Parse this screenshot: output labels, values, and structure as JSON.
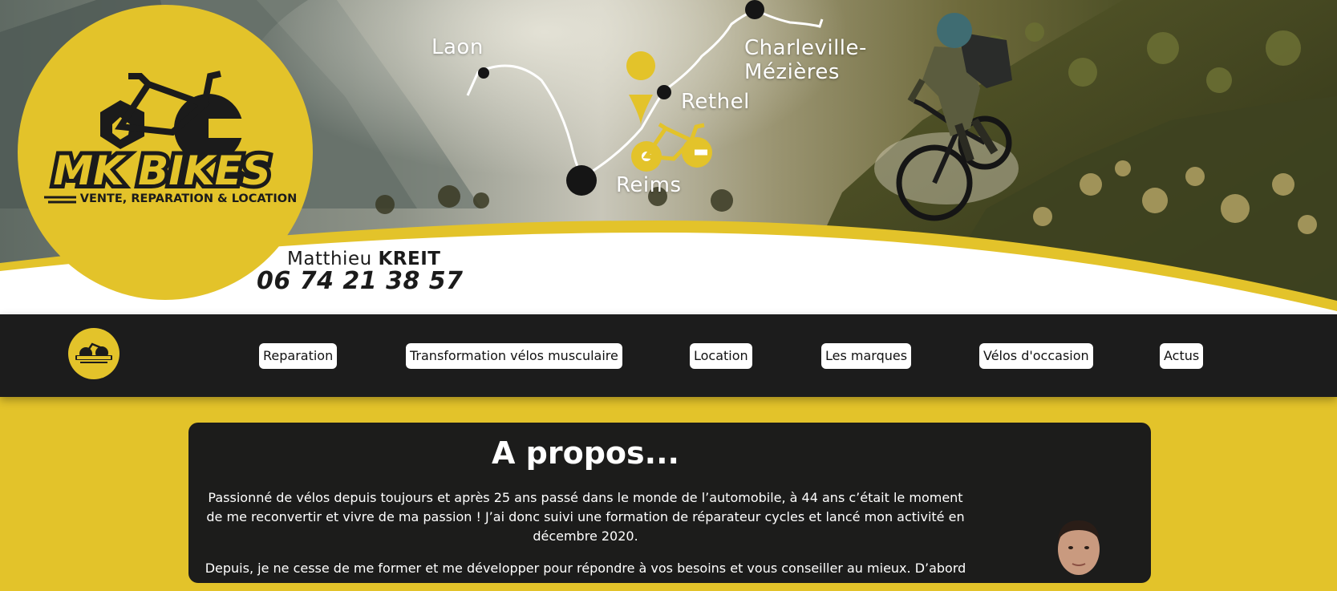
{
  "header": {
    "brand_name": "MK BIKES",
    "brand_tagline": "VENTE, REPARATION & LOCATION",
    "map_cities": {
      "laon": "Laon",
      "charleville_line1": "Charleville-",
      "charleville_line2": "Mézières",
      "rethel": "Rethel",
      "reims": "Reims"
    },
    "contact_first_name": "Matthieu",
    "contact_last_name": "KREIT",
    "contact_phone": "06 74 21 38 57"
  },
  "nav": {
    "items": [
      {
        "label": "Reparation"
      },
      {
        "label": "Transformation vélos musculaire"
      },
      {
        "label": "Location"
      },
      {
        "label": "Les marques"
      },
      {
        "label": "Vélos d'occasion"
      },
      {
        "label": "Actus"
      }
    ]
  },
  "about": {
    "title": "A propos...",
    "paragraph_1": "Passionné de vélos depuis toujours et après 25 ans passé dans le monde de l’automobile, à 44 ans c’était le moment de me reconvertir et vivre de ma passion ! J’ai donc suivi une formation de réparateur cycles et lancé mon activité en décembre 2020.",
    "paragraph_2": "Depuis, je ne cesse de me former et me développer pour répondre à vos besoins et vous conseiller au mieux. D’abord"
  },
  "colors": {
    "brand_yellow": "#e3c32a",
    "dark": "#1c1c1c",
    "white": "#ffffff"
  },
  "icons": {
    "logo": "bike-nut-wrench-logo",
    "map_pin": "map-pin-icon",
    "bike_mark": "bike-icon"
  }
}
